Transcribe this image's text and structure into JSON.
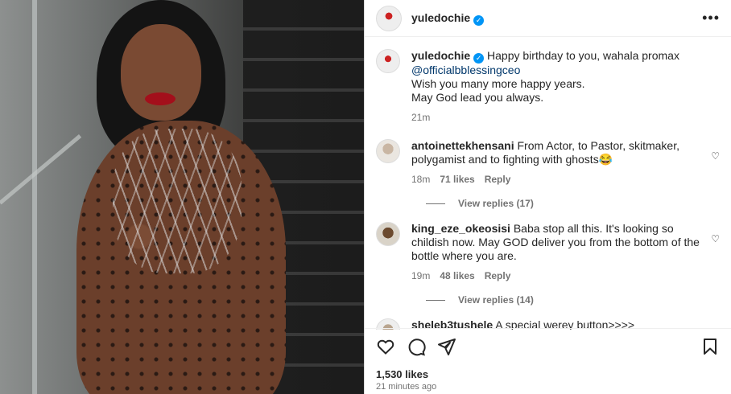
{
  "post": {
    "username": "yuledochie",
    "verified_icon": "verified-badge-icon",
    "more_icon": "more-options-icon",
    "more_label": "•••"
  },
  "caption": {
    "username": "yuledochie",
    "text_1": "Happy birthday to you, wahala promax",
    "mention": "@officialbblessingceo",
    "text_2": "Wish you many more happy years.",
    "text_3": "May God lead you always.",
    "time": "21m"
  },
  "comments": [
    {
      "username": "antoinettekhensani",
      "text": "From Actor, to Pastor, skitmaker, polygamist and to fighting with ghosts😂",
      "time": "18m",
      "likes": "71 likes",
      "reply": "Reply",
      "view_replies": "View replies (17)"
    },
    {
      "username": "king_eze_okeosisi",
      "text": "Baba stop all this. It's looking so childish now. May GOD deliver you from the bottom of the bottle where you are.",
      "time": "19m",
      "likes": "48 likes",
      "reply": "Reply",
      "view_replies": "View replies (14)"
    },
    {
      "username": "sheleb3tushele",
      "text": "A special werey button>>>>"
    }
  ],
  "actions": {
    "like_icon": "heart-icon",
    "comment_icon": "comment-icon",
    "share_icon": "share-icon",
    "save_icon": "bookmark-icon"
  },
  "stats": {
    "likes": "1,530 likes",
    "posted": "21 minutes ago"
  },
  "colors": {
    "verified": "#0095f6",
    "mention": "#00376b",
    "secondary_text": "#737373"
  }
}
